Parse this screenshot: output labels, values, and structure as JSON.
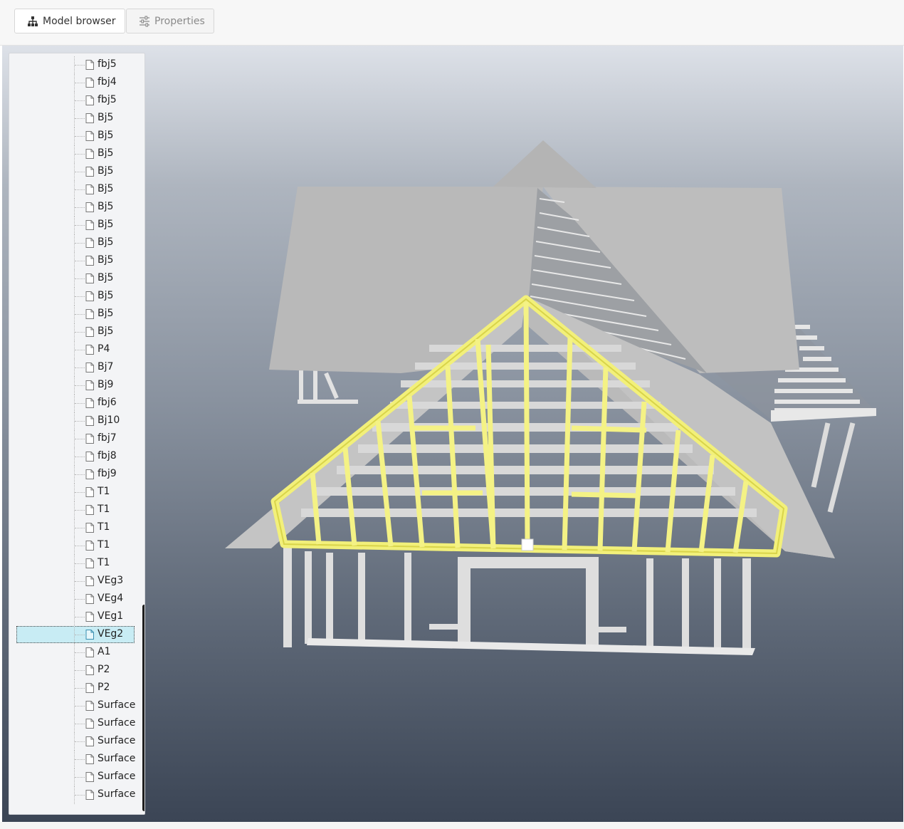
{
  "tabs": {
    "model_browser": "Model browser",
    "properties": "Properties",
    "model_browser_icon": "hierarchy-icon",
    "properties_icon": "sliders-icon"
  },
  "tree": {
    "items": [
      {
        "label": "fbj5"
      },
      {
        "label": "fbj4"
      },
      {
        "label": "fbj5"
      },
      {
        "label": "Bj5"
      },
      {
        "label": "Bj5"
      },
      {
        "label": "Bj5"
      },
      {
        "label": "Bj5"
      },
      {
        "label": "Bj5"
      },
      {
        "label": "Bj5"
      },
      {
        "label": "Bj5"
      },
      {
        "label": "Bj5"
      },
      {
        "label": "Bj5"
      },
      {
        "label": "Bj5"
      },
      {
        "label": "Bj5"
      },
      {
        "label": "Bj5"
      },
      {
        "label": "Bj5"
      },
      {
        "label": "P4"
      },
      {
        "label": "Bj7"
      },
      {
        "label": "Bj9"
      },
      {
        "label": "fbj6"
      },
      {
        "label": "Bj10"
      },
      {
        "label": "fbj7"
      },
      {
        "label": "fbj8"
      },
      {
        "label": "fbj9"
      },
      {
        "label": "T1"
      },
      {
        "label": "T1"
      },
      {
        "label": "T1"
      },
      {
        "label": "T1"
      },
      {
        "label": "T1"
      },
      {
        "label": "VEg3"
      },
      {
        "label": "VEg4"
      },
      {
        "label": "VEg1"
      },
      {
        "label": "VEg2",
        "selected": true
      },
      {
        "label": "A1"
      },
      {
        "label": "P2"
      },
      {
        "label": "P2"
      },
      {
        "label": "Surface"
      },
      {
        "label": "Surface"
      },
      {
        "label": "Surface"
      },
      {
        "label": "Surface"
      },
      {
        "label": "Surface"
      },
      {
        "label": "Surface"
      }
    ],
    "item_icon": "document-icon"
  },
  "colors": {
    "highlight": "#f2f07a",
    "selection": "#c8ecf4",
    "roof": "#b8b8b8",
    "frame": "#e4e4e4"
  }
}
